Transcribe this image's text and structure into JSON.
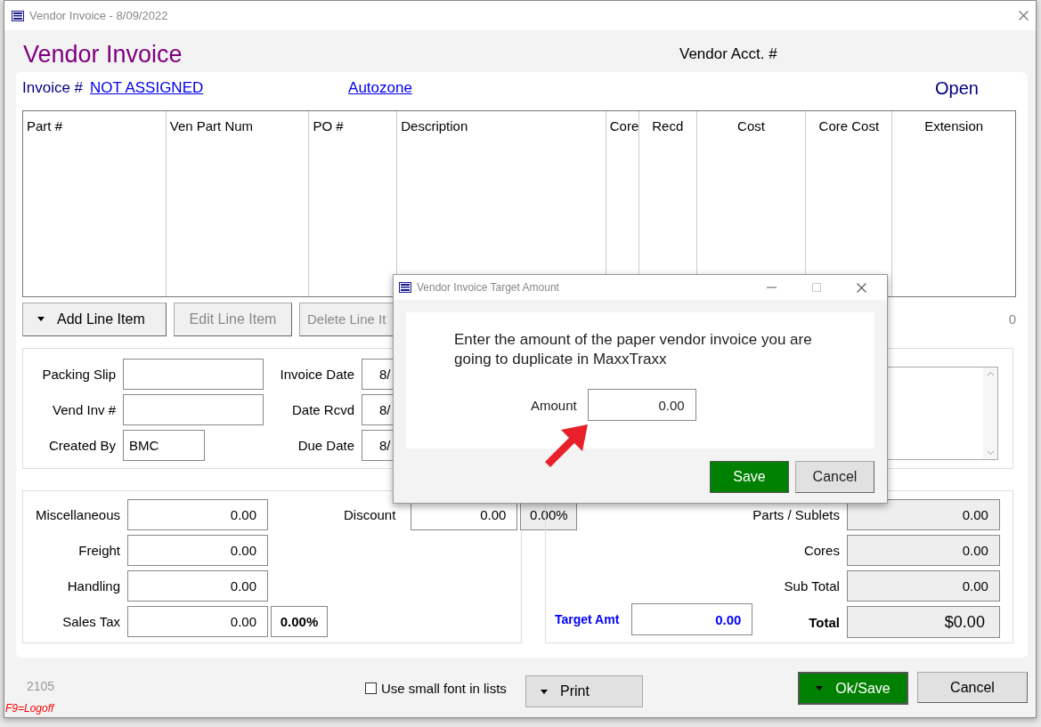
{
  "window": {
    "title": "Vendor Invoice - 8/09/2022"
  },
  "header": {
    "title": "Vendor Invoice",
    "vendor_acct_label": "Vendor Acct. #",
    "invoice_label": "Invoice #",
    "invoice_number": "NOT ASSIGNED",
    "vendor": "Autozone",
    "status": "Open"
  },
  "table": {
    "columns": [
      {
        "label": "Part #"
      },
      {
        "label": "Ven Part Num"
      },
      {
        "label": "PO #"
      },
      {
        "label": "Description"
      },
      {
        "label": "Core"
      },
      {
        "label": "Recd"
      },
      {
        "label": "Cost"
      },
      {
        "label": "Core Cost"
      },
      {
        "label": "Extension"
      }
    ]
  },
  "line_buttons": [
    {
      "label": "Add Line Item",
      "disabled": false
    },
    {
      "label": "Edit Line Item",
      "disabled": true
    },
    {
      "label": "Delete Line It",
      "disabled": true
    }
  ],
  "line_count": "0",
  "info_fields": [
    {
      "label": "Packing Slip"
    },
    {
      "label": "Vend Inv #"
    },
    {
      "label": "Created By",
      "value": "BMC"
    }
  ],
  "date_fields": [
    {
      "label": "Invoice Date",
      "value": "8/"
    },
    {
      "label": "Date Rcvd",
      "value": "8/"
    },
    {
      "label": "Due Date",
      "value": "8/"
    }
  ],
  "charges": [
    {
      "label": "Miscellaneous",
      "value": "0.00"
    },
    {
      "label": "Freight",
      "value": "0.00"
    },
    {
      "label": "Handling",
      "value": "0.00"
    },
    {
      "label": "Sales Tax",
      "value": "0.00",
      "percent": "0.00%"
    }
  ],
  "discount": {
    "label": "Discount",
    "value": "0.00",
    "percent": "0.00%"
  },
  "target": {
    "label": "Target Amt",
    "value": "0.00"
  },
  "totals": [
    {
      "label": "Parts / Sublets",
      "value": "0.00",
      "kind": "line"
    },
    {
      "label": "Cores",
      "value": "0.00",
      "kind": "line"
    },
    {
      "label": "Sub Total",
      "value": "0.00",
      "kind": "line"
    },
    {
      "label": "Total",
      "value": "$0.00",
      "kind": "grand"
    }
  ],
  "footer": {
    "code": "2105",
    "hotkey": "F9=Logoff",
    "small_font": {
      "label": "Use small font in lists",
      "checked": false
    },
    "print_button": "Print",
    "ok_button": "Ok/Save",
    "cancel_button": "Cancel"
  },
  "dialog": {
    "title": "Vendor Invoice Target Amount",
    "message": "Enter the amount of the paper vendor invoice you are going to duplicate in MaxxTraxx",
    "amount_label": "Amount",
    "amount_value": "0.00",
    "save_button": "Save",
    "cancel_button": "Cancel"
  }
}
